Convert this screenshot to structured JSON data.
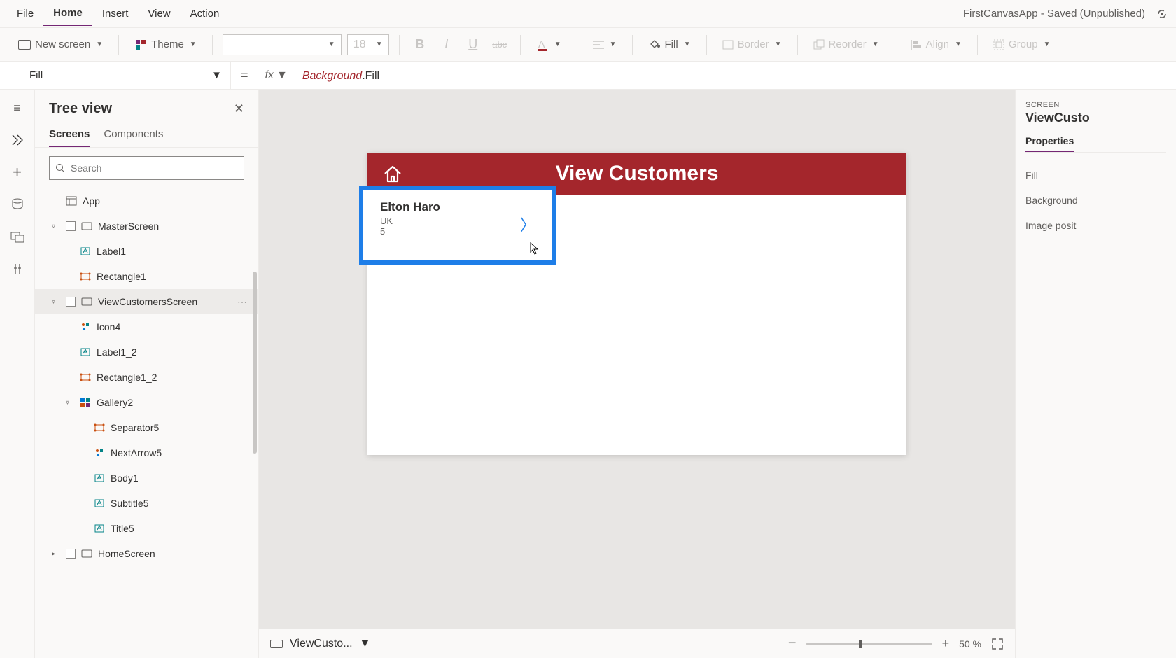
{
  "menu": {
    "items": [
      "File",
      "Home",
      "Insert",
      "View",
      "Action"
    ],
    "active_index": 1,
    "app_title": "FirstCanvasApp - Saved (Unpublished)"
  },
  "ribbon": {
    "new_screen": "New screen",
    "theme": "Theme",
    "font_size": "18",
    "fill": "Fill",
    "border": "Border",
    "reorder": "Reorder",
    "align": "Align",
    "group": "Group"
  },
  "formula": {
    "property": "Fill",
    "fx": "fx",
    "expr_bg": "Background",
    "expr_rest": ".Fill"
  },
  "tree": {
    "title": "Tree view",
    "tabs": [
      "Screens",
      "Components"
    ],
    "active_tab": 0,
    "search_placeholder": "Search",
    "items": [
      {
        "label": "App",
        "depth": 1,
        "icon": "app",
        "caret": "none"
      },
      {
        "label": "MasterScreen",
        "depth": 1,
        "icon": "screen",
        "caret": "open",
        "check": true
      },
      {
        "label": "Label1",
        "depth": 2,
        "icon": "label",
        "caret": "none"
      },
      {
        "label": "Rectangle1",
        "depth": 2,
        "icon": "rect",
        "caret": "none"
      },
      {
        "label": "ViewCustomersScreen",
        "depth": 1,
        "icon": "screen",
        "caret": "open",
        "check": true,
        "selected": true,
        "more": true
      },
      {
        "label": "Icon4",
        "depth": 2,
        "icon": "iconctrl",
        "caret": "none"
      },
      {
        "label": "Label1_2",
        "depth": 2,
        "icon": "label",
        "caret": "none"
      },
      {
        "label": "Rectangle1_2",
        "depth": 2,
        "icon": "rect",
        "caret": "none"
      },
      {
        "label": "Gallery2",
        "depth": 2,
        "icon": "gallery",
        "caret": "open"
      },
      {
        "label": "Separator5",
        "depth": 3,
        "icon": "rect",
        "caret": "none"
      },
      {
        "label": "NextArrow5",
        "depth": 3,
        "icon": "iconctrl",
        "caret": "none"
      },
      {
        "label": "Body1",
        "depth": 3,
        "icon": "label",
        "caret": "none"
      },
      {
        "label": "Subtitle5",
        "depth": 3,
        "icon": "label",
        "caret": "none"
      },
      {
        "label": "Title5",
        "depth": 3,
        "icon": "label",
        "caret": "none"
      },
      {
        "label": "HomeScreen",
        "depth": 1,
        "icon": "screen",
        "caret": "closed",
        "check": true
      }
    ]
  },
  "canvas": {
    "header_title": "View Customers",
    "gallery": {
      "title": "Elton  Haro",
      "subtitle": "UK",
      "body": "5"
    }
  },
  "canvas_footer": {
    "screen_label": "ViewCusto...",
    "zoom": "50",
    "zoom_unit": "%"
  },
  "props": {
    "label": "SCREEN",
    "object": "ViewCusto",
    "tabs": [
      "Properties"
    ],
    "rows": [
      "Fill",
      "Background",
      "Image posit"
    ]
  }
}
